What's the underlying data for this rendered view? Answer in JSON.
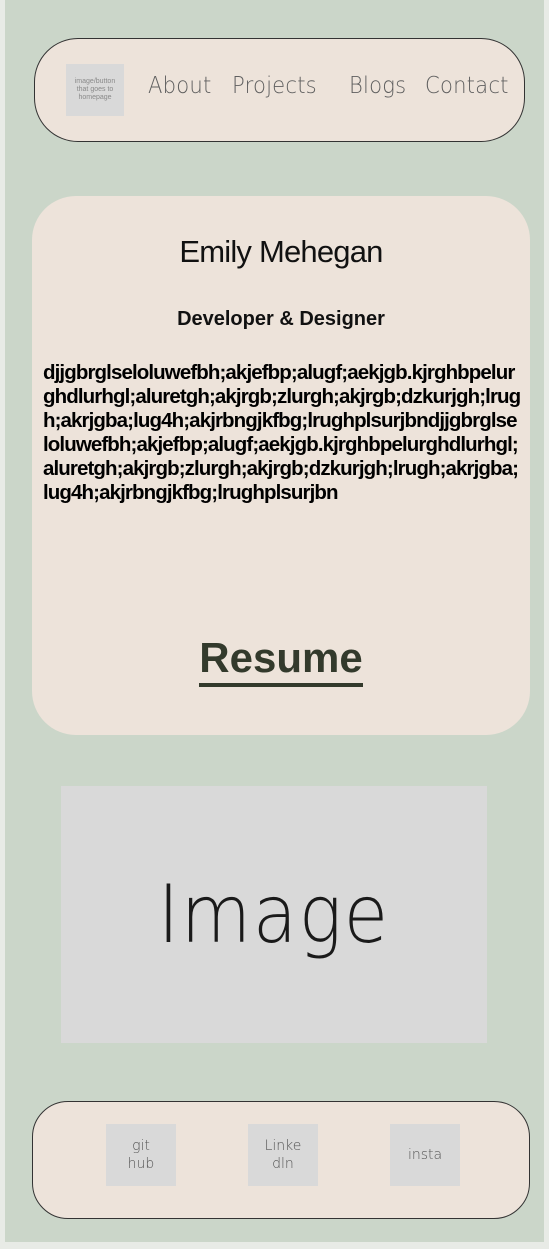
{
  "nav": {
    "logo_text": "image/button that goes to homepage",
    "links": [
      "About",
      "Projects",
      "Blogs",
      "Contact"
    ]
  },
  "hero": {
    "name": "Emily Mehegan",
    "role": "Developer & Designer",
    "bio": "djjgbrglseloluwefbh;akjefbp;alugf;aekjgb.kjrghbpelurghdlurhgl;aluretgh;akjrgb;zlurgh;akjrgb;dzkurjgh;lrugh;akrjgba;lug4h;akjrbngjkfbg;lrughplsurjbndjjgbrglseloluwefbh;akjefbp;alugf;aekjgb.kjrghbpelurghdlurhgl;aluretgh;akjrgb;zlurgh;akjrgb;dzkurjgh;lrugh;akrjgba;lug4h;akjrbngjkfbg;lrughplsurjbn",
    "resume_label": "Resume"
  },
  "image_placeholder": "Image",
  "footer": {
    "github": "git hub",
    "linkedin": "Linke dln",
    "instagram": "insta"
  }
}
